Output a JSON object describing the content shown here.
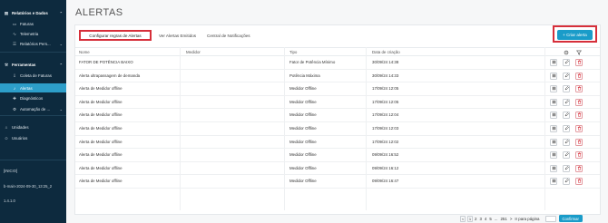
{
  "sidebar": {
    "items": [
      {
        "label": "Relatórios e Dados",
        "icon": "chart-icon",
        "type": "group"
      },
      {
        "label": "Faturas",
        "icon": "document-icon",
        "type": "sub"
      },
      {
        "label": "Telemetria",
        "icon": "telemetry-icon",
        "type": "sub"
      },
      {
        "label": "Relatórios Pers...",
        "icon": "report-icon",
        "type": "sub"
      },
      {
        "label": "Ferramentas",
        "icon": "wrench-icon",
        "type": "group"
      },
      {
        "label": "Coleta de Faturas",
        "icon": "download-icon",
        "type": "sub"
      },
      {
        "label": "Alertas",
        "icon": "bell-icon",
        "type": "sub"
      },
      {
        "label": "Diagnósticos",
        "icon": "diagnostic-icon",
        "type": "sub"
      },
      {
        "label": "Automação de ...",
        "icon": "automation-icon",
        "type": "sub"
      },
      {
        "label": "Unidades",
        "icon": "building-icon",
        "type": "top"
      },
      {
        "label": "Usuários",
        "icon": "user-icon",
        "type": "top"
      }
    ],
    "meta": [
      "[INICIO]",
      "b-main-2024-09-30_13:25_2",
      "1.4.1.0"
    ]
  },
  "page": {
    "title": "ALERTAS"
  },
  "tabs": [
    "Configurar regras de Alertas",
    "Ver Alertas Emitidos",
    "Central de Notificações"
  ],
  "create_button": "+ Criar alerta",
  "table": {
    "columns": [
      "Nome",
      "Medidor",
      "Tipo",
      "Data de criação"
    ],
    "header_icons": [
      "settings-icon",
      "filter-icon"
    ],
    "rows": [
      {
        "nome": "FATOR DE POTÊNCIA BAIXO",
        "medidor": "",
        "tipo": "Fator de Potência Mínimo",
        "data": "30/09/24 14:38"
      },
      {
        "nome": "Alerta ultrapassagem de demanda",
        "medidor": "",
        "tipo": "Potência Máxima",
        "data": "30/09/24 14:33"
      },
      {
        "nome": "Alerta de Medidor offline",
        "medidor": "",
        "tipo": "Medidor Offline",
        "data": "17/09/24 12:05"
      },
      {
        "nome": "Alerta de Medidor offline",
        "medidor": "",
        "tipo": "Medidor Offline",
        "data": "17/09/24 12:05"
      },
      {
        "nome": "Alerta de Medidor offline",
        "medidor": "",
        "tipo": "Medidor Offline",
        "data": "17/09/24 12:04"
      },
      {
        "nome": "Alerta de Medidor offline",
        "medidor": "",
        "tipo": "Medidor Offline",
        "data": "17/09/24 12:03"
      },
      {
        "nome": "Alerta de Medidor offline",
        "medidor": "",
        "tipo": "Medidor Offline",
        "data": "17/09/24 12:02"
      },
      {
        "nome": "Alerta de Medidor offline",
        "medidor": "",
        "tipo": "Medidor Offline",
        "data": "09/09/24 16:52"
      },
      {
        "nome": "Alerta de Medidor offline",
        "medidor": "",
        "tipo": "Medidor Offline",
        "data": "09/09/24 16:12"
      },
      {
        "nome": "Alerta de Medidor offline",
        "medidor": "",
        "tipo": "Medidor Offline",
        "data": "09/09/24 16:47"
      }
    ]
  },
  "pagination": {
    "prev": "<",
    "pages": [
      "1",
      "2",
      "3",
      "4",
      "5",
      "...",
      "251"
    ],
    "next": ">",
    "goto_label": "Ir para página",
    "confirm": "Confirmar"
  },
  "colors": {
    "sidebar_bg": "#0d2a3e",
    "active": "#2d9ec9",
    "primary": "#1a9cc9",
    "highlight": "#d62f3a",
    "delete": "#d62f3a"
  }
}
